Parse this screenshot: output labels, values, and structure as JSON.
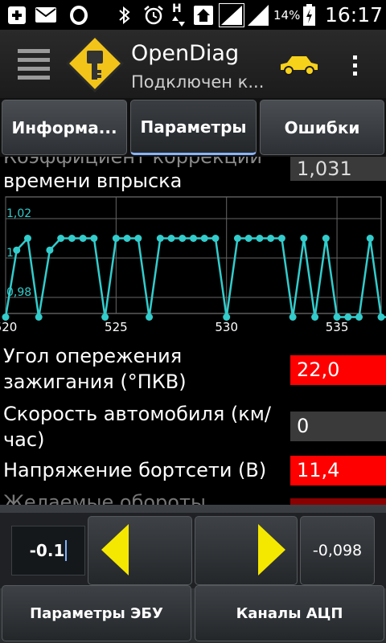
{
  "status": {
    "battery": "14%",
    "time": "16:17",
    "network_label": "H"
  },
  "appbar": {
    "title": "OpenDiag",
    "subtitle": "Подключен к..."
  },
  "tabs": [
    {
      "label": "Информа..."
    },
    {
      "label": "Параметры"
    },
    {
      "label": "Ошибки"
    }
  ],
  "params": {
    "injection": {
      "label_top": "Коэффициент коррекции",
      "label_bottom": "времени впрыска",
      "value": "1,031"
    },
    "ignition": {
      "label_top": "Угол опережения",
      "label_bottom": "зажигания (°ПКВ)",
      "value": "22,0"
    },
    "speed": {
      "label_top": "Скорость автомобиля (км/",
      "label_bottom": "час)",
      "value": "0"
    },
    "voltage": {
      "label": "Напряжение бортсети (В)",
      "value": "11,4"
    },
    "idle": {
      "label": "Желаемые обороты"
    }
  },
  "chart_data": {
    "type": "line",
    "y_tick_labels": [
      "1,02",
      "1",
      "0,98"
    ],
    "x_tick_labels": [
      "520",
      "525",
      "530",
      "535"
    ],
    "ylim": [
      0.97,
      1.03
    ],
    "xlim": [
      520,
      537.2
    ],
    "grid": true,
    "color": "#33cccc",
    "x": [
      520,
      520.5,
      521,
      521.5,
      522,
      522.5,
      523,
      523.5,
      524,
      524.5,
      525,
      525.5,
      526,
      526.5,
      527,
      527.5,
      528,
      528.5,
      529,
      529.5,
      530,
      530.5,
      531,
      531.5,
      532,
      532.5,
      533,
      533.5,
      534,
      534.5,
      535,
      535.5,
      536,
      536.5,
      537
    ],
    "y": [
      0.97,
      1.004,
      1.01,
      0.97,
      1.004,
      1.01,
      1.01,
      1.01,
      1.01,
      0.97,
      1.01,
      1.01,
      1.01,
      0.97,
      1.01,
      1.01,
      1.01,
      1.01,
      1.01,
      1.01,
      0.97,
      1.01,
      1.01,
      1.01,
      1.01,
      1.01,
      0.97,
      1.01,
      0.97,
      1.01,
      0.97,
      0.97,
      0.97,
      1.01,
      0.97,
      0.97,
      1.01,
      1.031
    ],
    "points_x": [
      520,
      520.5,
      521,
      521.5,
      522,
      522.5,
      523,
      523.5,
      524,
      524.5,
      525,
      525.5,
      526,
      526.5,
      527,
      527.5,
      528,
      528.5,
      529,
      529.5,
      530,
      530.5,
      531,
      531.5,
      532,
      532.5,
      533,
      533.5,
      534,
      534.5,
      535,
      535.5,
      536,
      536.5,
      537,
      537.5,
      538,
      538.5
    ]
  },
  "control": {
    "step_value": "-0.1",
    "current_value": "-0,098"
  },
  "bottom_tabs": [
    {
      "label": "Параметры ЭБУ"
    },
    {
      "label": "Каналы АЦП"
    }
  ]
}
